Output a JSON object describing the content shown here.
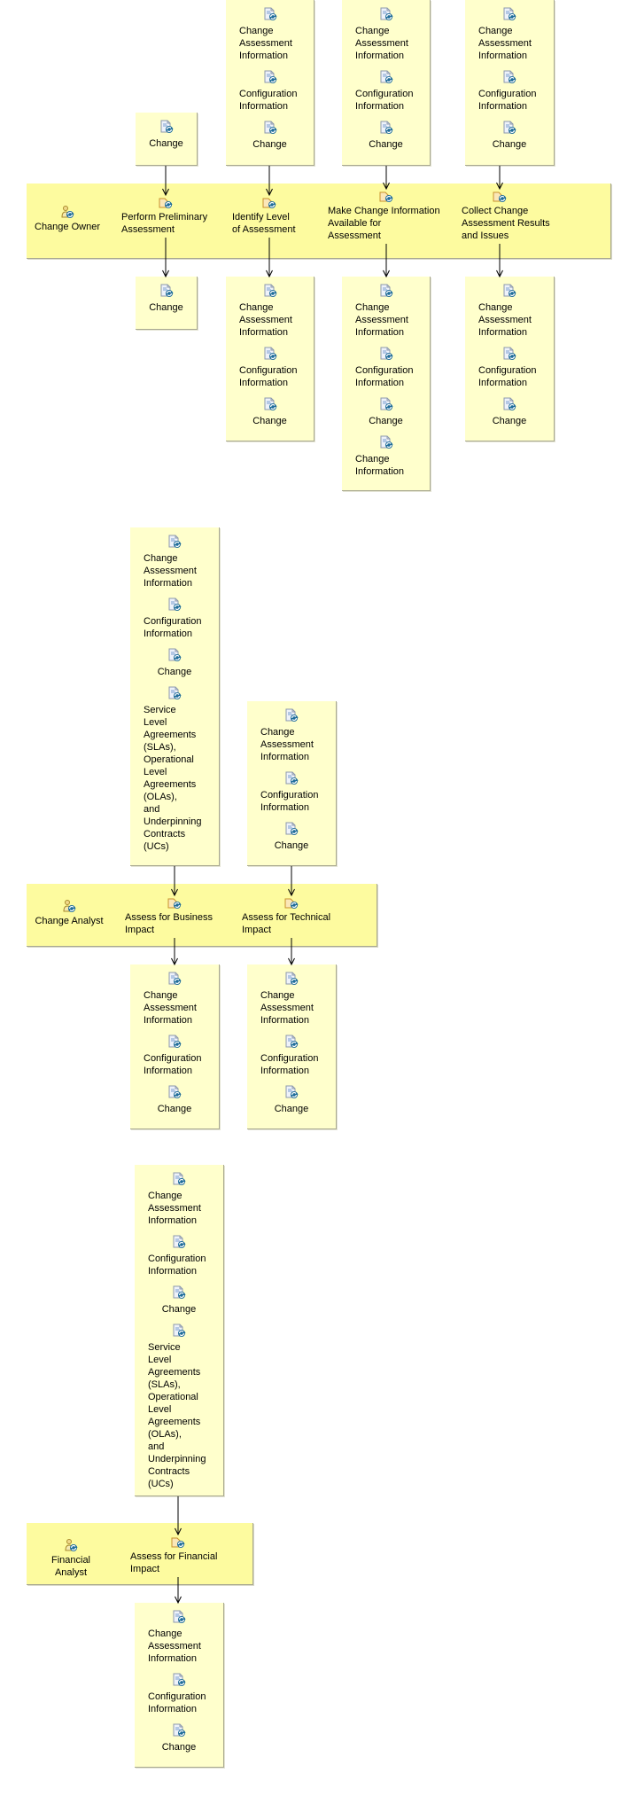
{
  "icons": {
    "artifact": "document-refresh-icon",
    "role": "person-refresh-icon",
    "activity": "task-refresh-icon"
  },
  "colors": {
    "lane_fill": "#fdfb9f",
    "box_fill": "#ffffcc",
    "border": "#a8a890",
    "connector": "#000000"
  },
  "lanes": [
    {
      "role": "Change Owner",
      "activities": [
        {
          "label": "Perform Preliminary\nAssessment",
          "inputs": [
            "Change"
          ],
          "outputs": [
            "Change"
          ]
        },
        {
          "label": "Identify Level\nof Assessment",
          "inputs": [
            "Change\nAssessment\nInformation",
            "Configuration\nInformation",
            "Change"
          ],
          "outputs": [
            "Change\nAssessment\nInformation",
            "Configuration\nInformation",
            "Change"
          ]
        },
        {
          "label": "Make Change Information\nAvailable for\nAssessment",
          "inputs": [
            "Change\nAssessment\nInformation",
            "Configuration\nInformation",
            "Change"
          ],
          "outputs": [
            "Change\nAssessment\nInformation",
            "Configuration\nInformation",
            "Change",
            "Change\nInformation"
          ]
        },
        {
          "label": "Collect Change\nAssessment Results\nand Issues",
          "inputs": [
            "Change\nAssessment\nInformation",
            "Configuration\nInformation",
            "Change"
          ],
          "outputs": [
            "Change\nAssessment\nInformation",
            "Configuration\nInformation",
            "Change"
          ]
        }
      ]
    },
    {
      "role": "Change Analyst",
      "activities": [
        {
          "label": "Assess for Business\nImpact",
          "inputs": [
            "Change\nAssessment\nInformation",
            "Configuration\nInformation",
            "Change",
            "Service\nLevel\nAgreements\n(SLAs),\nOperational\nLevel\nAgreements\n(OLAs),\nand\nUnderpinning\nContracts\n(UCs)"
          ],
          "outputs": [
            "Change\nAssessment\nInformation",
            "Configuration\nInformation",
            "Change"
          ]
        },
        {
          "label": "Assess for Technical\nImpact",
          "inputs": [
            "Change\nAssessment\nInformation",
            "Configuration\nInformation",
            "Change"
          ],
          "outputs": [
            "Change\nAssessment\nInformation",
            "Configuration\nInformation",
            "Change"
          ]
        }
      ]
    },
    {
      "role": "Financial Analyst",
      "activities": [
        {
          "label": "Assess for Financial\nImpact",
          "inputs": [
            "Change\nAssessment\nInformation",
            "Configuration\nInformation",
            "Change",
            "Service\nLevel\nAgreements\n(SLAs),\nOperational\nLevel\nAgreements\n(OLAs),\nand\nUnderpinning\nContracts\n(UCs)"
          ],
          "outputs": [
            "Change\nAssessment\nInformation",
            "Configuration\nInformation",
            "Change"
          ]
        }
      ]
    }
  ]
}
